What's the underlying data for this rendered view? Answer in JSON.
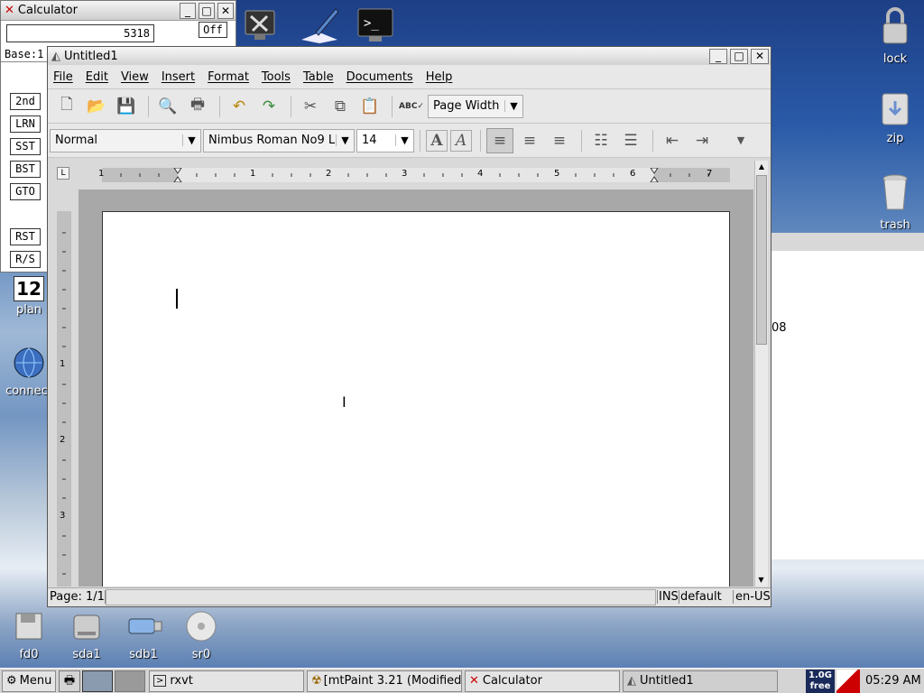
{
  "calculator": {
    "title": "Calculator",
    "display": "5318",
    "off_label": "Off",
    "base_label": "Base:1",
    "keys": [
      "2nd",
      "LRN",
      "SST",
      "BST",
      "GTO",
      "RST",
      "R/S"
    ]
  },
  "writer": {
    "title": "Untitled1",
    "menu": [
      "File",
      "Edit",
      "View",
      "Insert",
      "Format",
      "Tools",
      "Table",
      "Documents",
      "Help"
    ],
    "zoom": "Page Width",
    "style": "Normal",
    "font": "Nimbus Roman No9 L",
    "size": "14",
    "ruler": [
      "1",
      "1",
      "2",
      "3",
      "4",
      "5",
      "6",
      "7"
    ],
    "vruler": [
      "1",
      "2",
      "3"
    ],
    "status": {
      "page": "Page: 1/1",
      "mode": "INS",
      "lang_style": "default",
      "lang": "en-US"
    }
  },
  "desktop": {
    "icons_right": [
      "lock",
      "zip",
      "trash"
    ],
    "icons_left": [
      "plan",
      "connect"
    ],
    "drives": [
      "fd0",
      "sda1",
      "sdb1",
      "sr0"
    ],
    "plan_num": "12",
    "behind_text": "08"
  },
  "taskbar": {
    "menu": "Menu",
    "tasks": [
      "rxvt",
      "[mtPaint 3.21 (Modified",
      "Calculator",
      "Untitled1"
    ],
    "mem": "1.0G",
    "mem2": "free",
    "clock": "05:29 AM"
  }
}
